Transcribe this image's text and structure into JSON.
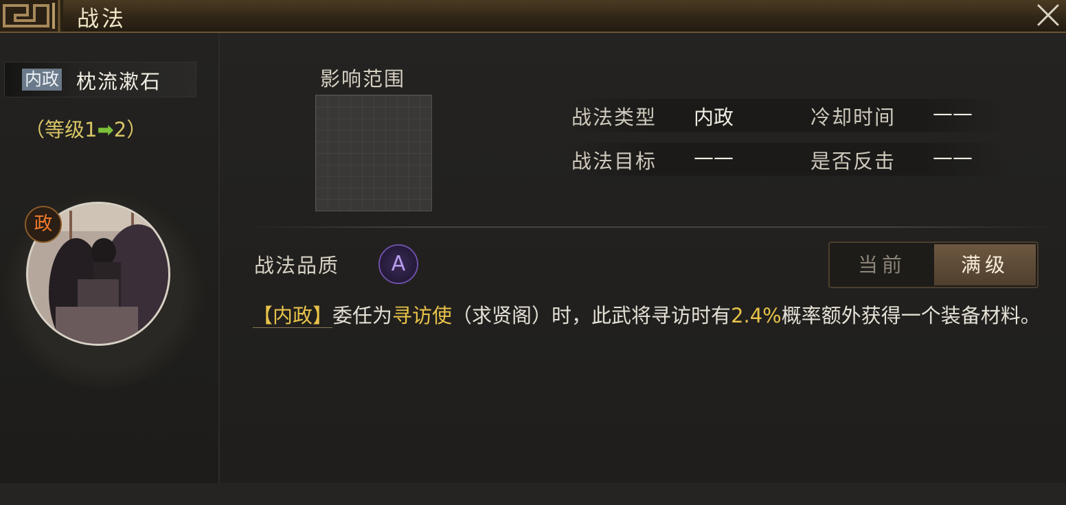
{
  "window": {
    "title": "战法",
    "close_icon": "close-icon"
  },
  "skill": {
    "type_tag": "内政",
    "name": "枕流漱石",
    "level_open": "（等级",
    "level_from": "1",
    "level_to": "2",
    "level_close": "）",
    "portrait_badge": "政"
  },
  "range": {
    "label": "影响范围"
  },
  "stats": {
    "type_label": "战法类型",
    "type_value": "内政",
    "cooldown_label": "冷却时间",
    "cooldown_value": "——",
    "target_label": "战法目标",
    "target_value": "——",
    "counter_label": "是否反击",
    "counter_value": "——"
  },
  "quality": {
    "label": "战法品质",
    "grade": "A"
  },
  "toggle": {
    "current": "当前",
    "max": "满级",
    "selected": "满级"
  },
  "description": {
    "tag": "【内政】",
    "part1": "委任为",
    "highlight1": "寻访使",
    "part2": "（求贤阁）时，此武将寻访时有",
    "highlight2": "2.4%",
    "part3": "概率额外获得一个装备材料。"
  },
  "colors": {
    "highlight": "#e8c24a",
    "level_arrow": "#7dc03a",
    "quality_purple": "#6d4fa8"
  }
}
